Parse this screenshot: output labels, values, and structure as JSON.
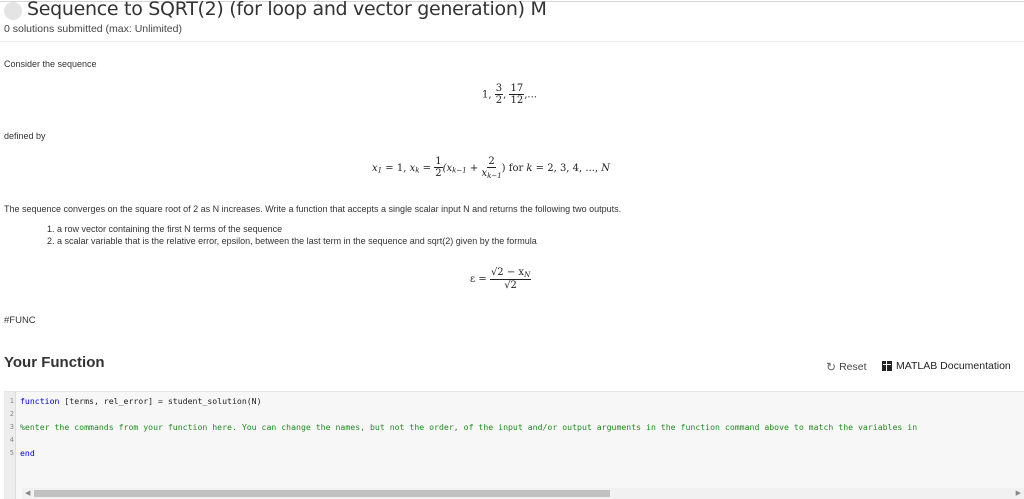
{
  "header": {
    "title": "Sequence to SQRT(2) (for loop and vector generation) M",
    "subtitle": "0 solutions submitted (max: Unlimited)"
  },
  "problem": {
    "consider": "Consider the sequence",
    "sequence": {
      "first": "1,",
      "f1_num": "3",
      "f1_den": "2",
      "sep": ",",
      "f2_num": "17",
      "f2_den": "12",
      "tail": ",..."
    },
    "defined_by": "defined by",
    "recurrence": {
      "lhs": "x",
      "lhs_sub": "1",
      "eq1": " = 1, ",
      "xk": "x",
      "xk_sub": "k",
      "eq2": " = ",
      "half_num": "1",
      "half_den": "2",
      "open": "(x",
      "open_sub": "k−1",
      "plus": " + ",
      "two_num": "2",
      "two_den": "x",
      "two_den_sub": "k−1",
      "close": ") for ",
      "k": "k",
      "range": " = 2, 3, 4, ..., ",
      "N": "N"
    },
    "description": "The sequence converges on the square root of 2 as N increases. Write a function that accepts a single scalar input N and returns the following two outputs.",
    "outputs": [
      "1. a row vector containing the first N terms of the sequence",
      "2. a scalar variable that is the relative error, epsilon, between the last term in the sequence and sqrt(2) given by the formula"
    ],
    "epsilon_formula": {
      "lhs": "ε =",
      "num": "√2 − x",
      "num_sub": "N",
      "den": "√2"
    },
    "func_tag": "#FUNC"
  },
  "function_section": {
    "title": "Your Function",
    "reset_label": "Reset",
    "doc_label": "MATLAB Documentation"
  },
  "editor": {
    "lines": [
      {
        "n": "1",
        "kw": "function",
        "text": " [terms, rel_error] = student_solution(N)"
      },
      {
        "n": "2",
        "text": ""
      },
      {
        "n": "3",
        "comment": "%enter the commands from your function here.  You can change the names, but not the order, of the input and/or output arguments in the function command above to match the variables in"
      },
      {
        "n": "4",
        "text": ""
      },
      {
        "n": "5",
        "kw": "end",
        "text": ""
      }
    ]
  }
}
